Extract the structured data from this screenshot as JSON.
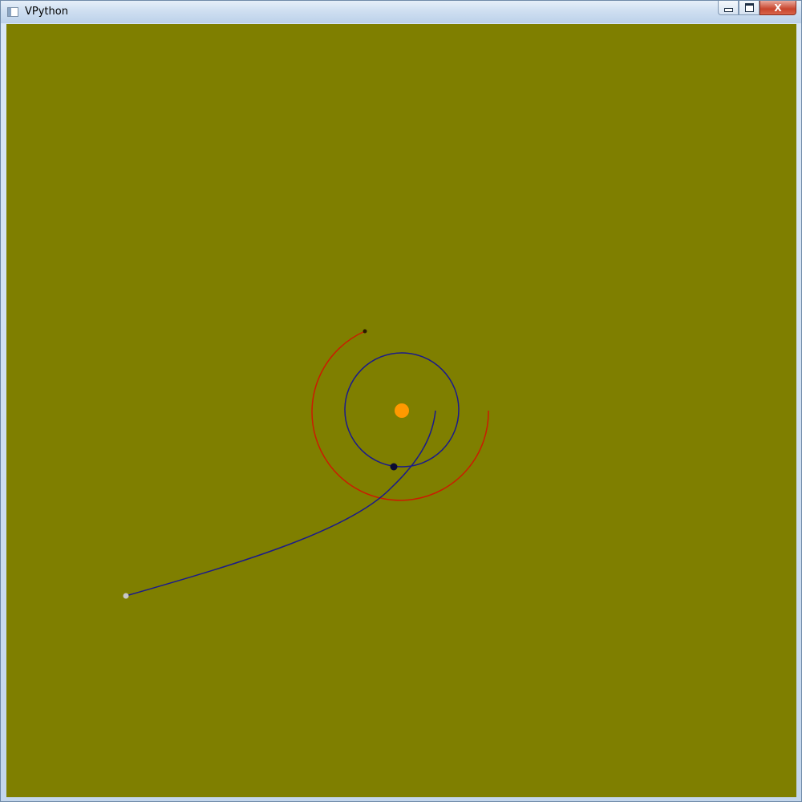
{
  "window": {
    "title": "VPython"
  },
  "controls": {
    "close_glyph": "X"
  },
  "scene": {
    "background_color": "#7f7f00",
    "sun_color": "#ff9900",
    "inner_orbit_color": "#1a1a8c",
    "outer_orbit_color": "#cc1a00",
    "probe_path_color": "#1a1a8c",
    "planet_color": "#0a0a33",
    "outer_planet_color": "#2a1a00",
    "probe_color": "#c8c8c8"
  }
}
